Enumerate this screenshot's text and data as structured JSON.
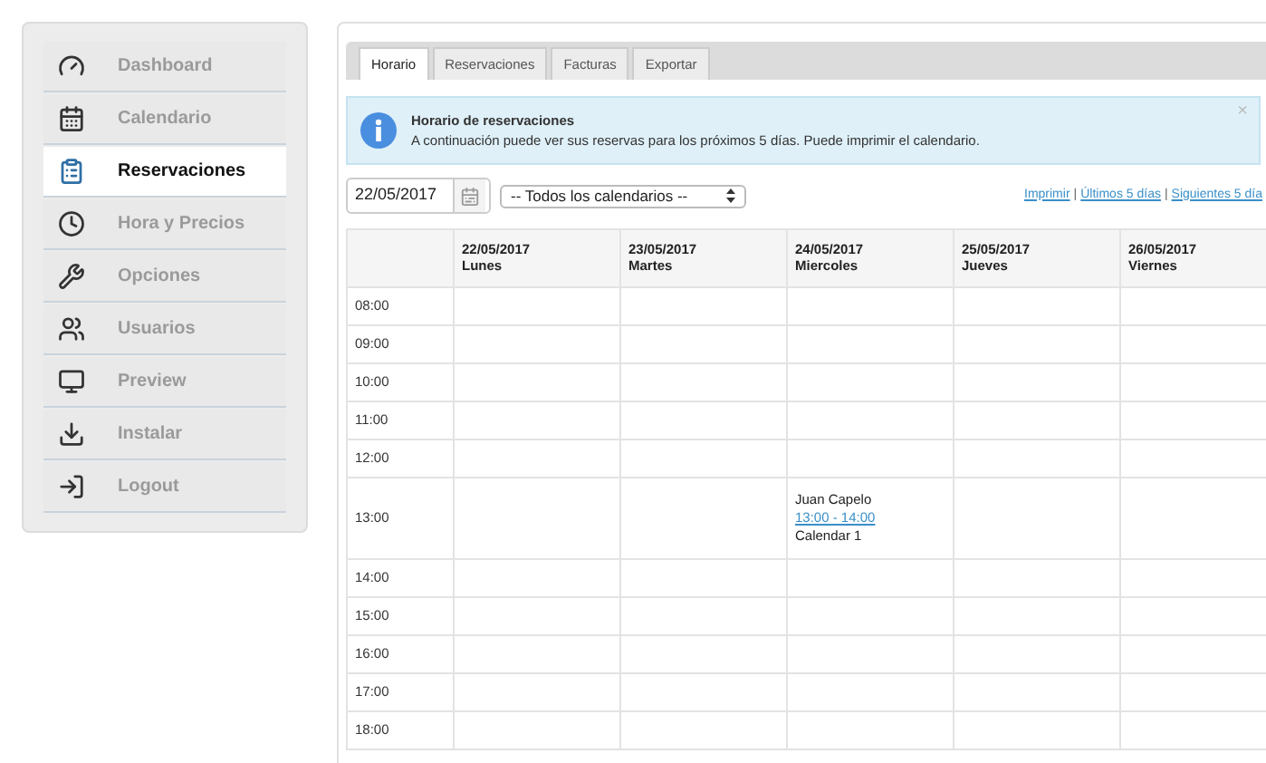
{
  "sidebar": {
    "items": [
      {
        "label": "Dashboard",
        "selected": false
      },
      {
        "label": "Calendario",
        "selected": false
      },
      {
        "label": "Reservaciones",
        "selected": true
      },
      {
        "label": "Hora y Precios",
        "selected": false
      },
      {
        "label": "Opciones",
        "selected": false
      },
      {
        "label": "Usuarios",
        "selected": false
      },
      {
        "label": "Preview",
        "selected": false
      },
      {
        "label": "Instalar",
        "selected": false
      },
      {
        "label": "Logout",
        "selected": false
      }
    ]
  },
  "tabs": [
    {
      "label": "Horario",
      "selected": true
    },
    {
      "label": "Reservaciones",
      "selected": false
    },
    {
      "label": "Facturas",
      "selected": false
    },
    {
      "label": "Exportar",
      "selected": false
    }
  ],
  "alert": {
    "title": "Horario de reservaciones",
    "message": "A continuación puede ver sus reservas para los próximos 5 días. Puede imprimir el calendario.",
    "close": "×"
  },
  "date_field": {
    "value": "22/05/2017"
  },
  "calendar_select": {
    "value": "-- Todos los calendarios --"
  },
  "links": [
    "Imprimir",
    "Últimos 5 días",
    "Siguientes 5 día"
  ],
  "link_separator": "|",
  "table": {
    "columns": [
      {
        "date": "22/05/2017",
        "day": "Lunes"
      },
      {
        "date": "23/05/2017",
        "day": "Martes"
      },
      {
        "date": "24/05/2017",
        "day": "Miercoles"
      },
      {
        "date": "25/05/2017",
        "day": "Jueves"
      },
      {
        "date": "26/05/2017",
        "day": "Viernes"
      }
    ],
    "rows": [
      {
        "time": "08:00",
        "cells": [
          {
            "kind": "empty"
          },
          {
            "kind": "empty"
          },
          {
            "kind": "empty"
          },
          {
            "kind": "empty"
          },
          {
            "kind": "empty"
          }
        ]
      },
      {
        "time": "09:00",
        "cells": [
          {
            "kind": "empty"
          },
          {
            "kind": "empty"
          },
          {
            "kind": "empty"
          },
          {
            "kind": "empty"
          },
          {
            "kind": "empty"
          }
        ]
      },
      {
        "time": "10:00",
        "cells": [
          {
            "kind": "empty"
          },
          {
            "kind": "empty"
          },
          {
            "kind": "empty"
          },
          {
            "kind": "empty"
          },
          {
            "kind": "empty"
          }
        ]
      },
      {
        "time": "11:00",
        "cells": [
          {
            "kind": "empty"
          },
          {
            "kind": "empty"
          },
          {
            "kind": "empty"
          },
          {
            "kind": "empty"
          },
          {
            "kind": "empty"
          }
        ]
      },
      {
        "time": "12:00",
        "cells": [
          {
            "kind": "empty"
          },
          {
            "kind": "empty"
          },
          {
            "kind": "empty"
          },
          {
            "kind": "empty"
          },
          {
            "kind": "empty"
          }
        ]
      },
      {
        "time": "13:00",
        "cells": [
          {
            "kind": "empty"
          },
          {
            "kind": "empty"
          },
          {
            "kind": "booking",
            "name": "Juan Capelo",
            "time": "13:00 - 14:00",
            "calendar": "Calendar 1"
          },
          {
            "kind": "empty"
          },
          {
            "kind": "empty"
          }
        ]
      },
      {
        "time": "14:00",
        "cells": [
          {
            "kind": "empty"
          },
          {
            "kind": "empty"
          },
          {
            "kind": "empty"
          },
          {
            "kind": "empty"
          },
          {
            "kind": "empty"
          }
        ]
      },
      {
        "time": "15:00",
        "cells": [
          {
            "kind": "empty"
          },
          {
            "kind": "empty"
          },
          {
            "kind": "empty"
          },
          {
            "kind": "empty"
          },
          {
            "kind": "empty"
          }
        ]
      },
      {
        "time": "16:00",
        "cells": [
          {
            "kind": "empty"
          },
          {
            "kind": "empty"
          },
          {
            "kind": "empty"
          },
          {
            "kind": "empty"
          },
          {
            "kind": "empty"
          }
        ]
      },
      {
        "time": "17:00",
        "cells": [
          {
            "kind": "empty"
          },
          {
            "kind": "empty"
          },
          {
            "kind": "empty"
          },
          {
            "kind": "empty"
          },
          {
            "kind": "empty"
          }
        ]
      },
      {
        "time": "18:00",
        "cells": [
          {
            "kind": "empty"
          },
          {
            "kind": "empty"
          },
          {
            "kind": "empty"
          },
          {
            "kind": "empty"
          },
          {
            "kind": "empty"
          }
        ]
      }
    ]
  }
}
